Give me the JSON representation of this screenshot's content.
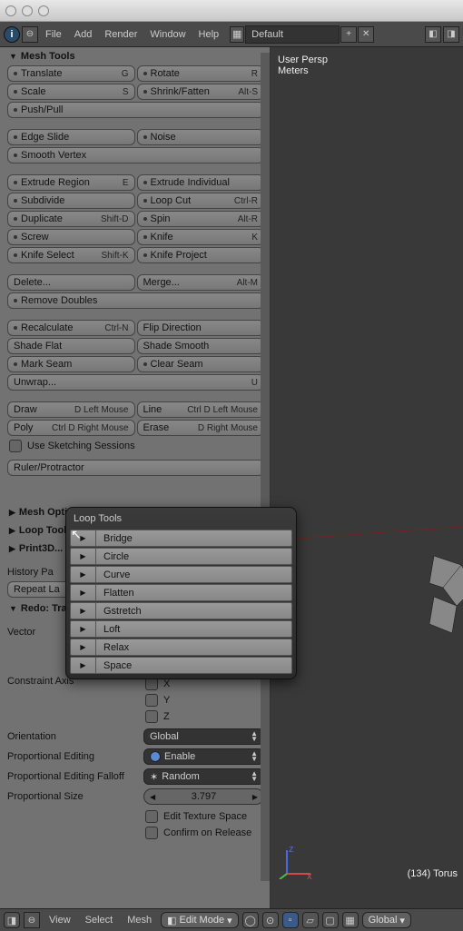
{
  "titlebar": {
    "buttons": [
      "close",
      "min",
      "zoom"
    ]
  },
  "menubar": {
    "items": [
      "File",
      "Add",
      "Render",
      "Window",
      "Help"
    ],
    "layout_name": "Default"
  },
  "viewport": {
    "persp": "User Persp",
    "object": "Meters",
    "status": "(134) Torus"
  },
  "tool_panel": {
    "mesh_tools_header": "Mesh Tools",
    "group0": [
      [
        {
          "l": "Translate",
          "sc": "G"
        },
        {
          "l": "Rotate",
          "sc": "R"
        }
      ],
      [
        {
          "l": "Scale",
          "sc": "S"
        },
        {
          "l": "Shrink/Fatten",
          "sc": "Alt-S"
        }
      ],
      [
        {
          "l": "Push/Pull"
        }
      ]
    ],
    "group1": [
      [
        {
          "l": "Edge Slide"
        },
        {
          "l": "Noise"
        }
      ],
      [
        {
          "l": "Smooth Vertex"
        }
      ]
    ],
    "group2": [
      [
        {
          "l": "Extrude Region",
          "sc": "E"
        },
        {
          "l": "Extrude Individual"
        }
      ],
      [
        {
          "l": "Subdivide"
        },
        {
          "l": "Loop Cut",
          "sc": "Ctrl-R"
        }
      ],
      [
        {
          "l": "Duplicate",
          "sc": "Shift-D"
        },
        {
          "l": "Spin",
          "sc": "Alt-R"
        }
      ],
      [
        {
          "l": "Screw"
        },
        {
          "l": "Knife",
          "sc": "K"
        }
      ],
      [
        {
          "l": "Knife Select",
          "sc": "Shift-K"
        },
        {
          "l": "Knife Project"
        }
      ]
    ],
    "group3": [
      [
        {
          "l": "Delete..."
        },
        {
          "l": "Merge...",
          "sc": "Alt-M"
        }
      ],
      [
        {
          "l": "Remove Doubles"
        }
      ]
    ],
    "group4": [
      [
        {
          "l": "Recalculate",
          "sc": "Ctrl-N"
        },
        {
          "l": "Flip Direction"
        }
      ],
      [
        {
          "l": "Shade  Flat"
        },
        {
          "l": "Shade Smooth"
        }
      ],
      [
        {
          "l": "Mark Seam"
        },
        {
          "l": "Clear Seam"
        }
      ],
      [
        {
          "l": "Unwrap...",
          "sc": "U"
        }
      ]
    ],
    "group5": [
      [
        {
          "l": "Draw",
          "sc": "D Left Mouse"
        },
        {
          "l": "Line",
          "sc": "Ctrl D Left Mouse"
        }
      ],
      [
        {
          "l": "Poly",
          "sc": "Ctrl D Right Mouse"
        },
        {
          "l": "Erase",
          "sc": "D Right Mouse"
        }
      ]
    ],
    "use_sketching": "Use Sketching Sessions",
    "ruler": "Ruler/Protractor",
    "collapsed_headers": [
      "Mesh Options...",
      "Loop Tool",
      "Print3D..."
    ],
    "history_label": "History Pa",
    "repeat_last": "Repeat La",
    "redo_header": "Redo: Tra",
    "vector_label": "Vector",
    "constraint_label": "Constraint Axis",
    "constraint_axes": [
      "X",
      "Y",
      "Z"
    ],
    "orientation_label": "Orientation",
    "orientation_value": "Global",
    "prop_edit_label": "Proportional Editing",
    "prop_edit_value": "Enable",
    "prop_falloff_label": "Proportional Editing Falloff",
    "prop_falloff_value": "Random",
    "prop_size_label": "Proportional Size",
    "prop_size_value": "3.797",
    "edit_tex_label": "Edit Texture Space",
    "confirm_label": "Confirm on Release"
  },
  "popup": {
    "title": "Loop Tools",
    "items": [
      "Bridge",
      "Circle",
      "Curve",
      "Flatten",
      "Gstretch",
      "Loft",
      "Relax",
      "Space"
    ]
  },
  "bottom_bar": {
    "menus": [
      "View",
      "Select",
      "Mesh"
    ],
    "mode": "Edit Mode",
    "orientation": "Global"
  }
}
